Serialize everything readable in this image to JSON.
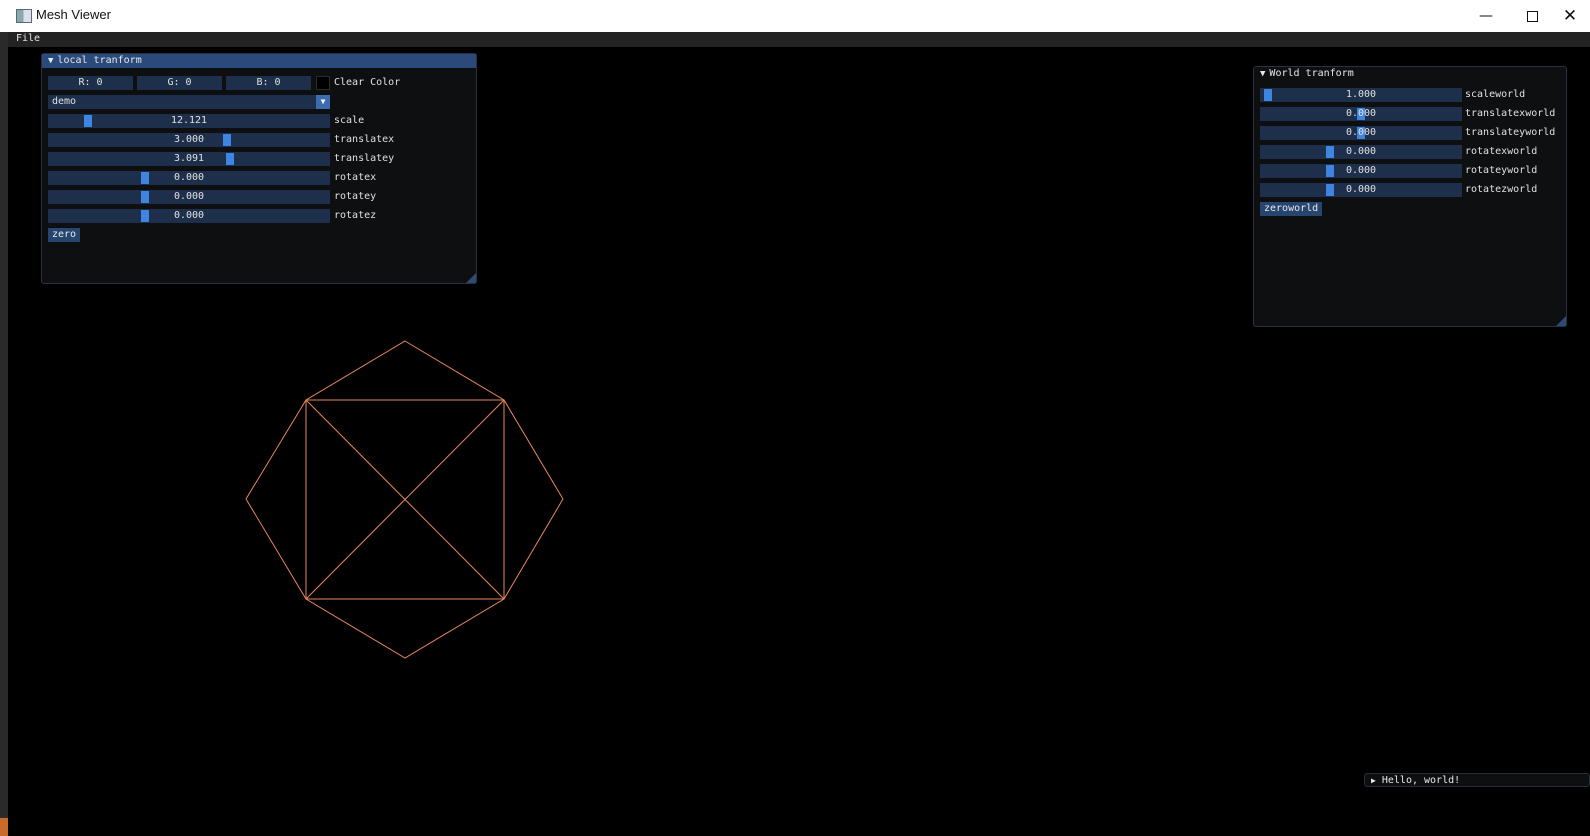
{
  "window": {
    "title": "Mesh Viewer",
    "icon": "app-window-icon"
  },
  "menu": {
    "file": "File"
  },
  "local_panel": {
    "title": "local tranform",
    "color": {
      "r": "R:  0",
      "g": "G:  0",
      "b": "B:  0",
      "label": "Clear Color"
    },
    "combo": {
      "value": "demo"
    },
    "sliders": [
      {
        "value": "12.121",
        "label": "scale",
        "fraction": 0.13
      },
      {
        "value": "3.000",
        "label": "translatex",
        "fraction": 0.64
      },
      {
        "value": "3.091",
        "label": "translatey",
        "fraction": 0.65
      },
      {
        "value": "0.000",
        "label": "rotatex",
        "fraction": 0.34
      },
      {
        "value": "0.000",
        "label": "rotatey",
        "fraction": 0.34
      },
      {
        "value": "0.000",
        "label": "rotatez",
        "fraction": 0.34
      }
    ],
    "button": "zero"
  },
  "world_panel": {
    "title": "World tranform",
    "sliders": [
      {
        "value": "1.000",
        "label": "scaleworld",
        "fraction": 0.02
      },
      {
        "value": "0.000",
        "label": "translatexworld",
        "fraction": 0.5
      },
      {
        "value": "0.000",
        "label": "translateyworld",
        "fraction": 0.5
      },
      {
        "value": "0.000",
        "label": "rotatexworld",
        "fraction": 0.34
      },
      {
        "value": "0.000",
        "label": "rotateyworld",
        "fraction": 0.34
      },
      {
        "value": "0.000",
        "label": "rotatezworld",
        "fraction": 0.34
      }
    ],
    "button": "zeroworld"
  },
  "hello_window": {
    "title": "Hello, world!"
  },
  "colors": {
    "mesh_stroke": "#e8865a",
    "accent": "#3d85e0",
    "frame_bg": "#1d2f4a",
    "title_active": "#294a7a"
  }
}
